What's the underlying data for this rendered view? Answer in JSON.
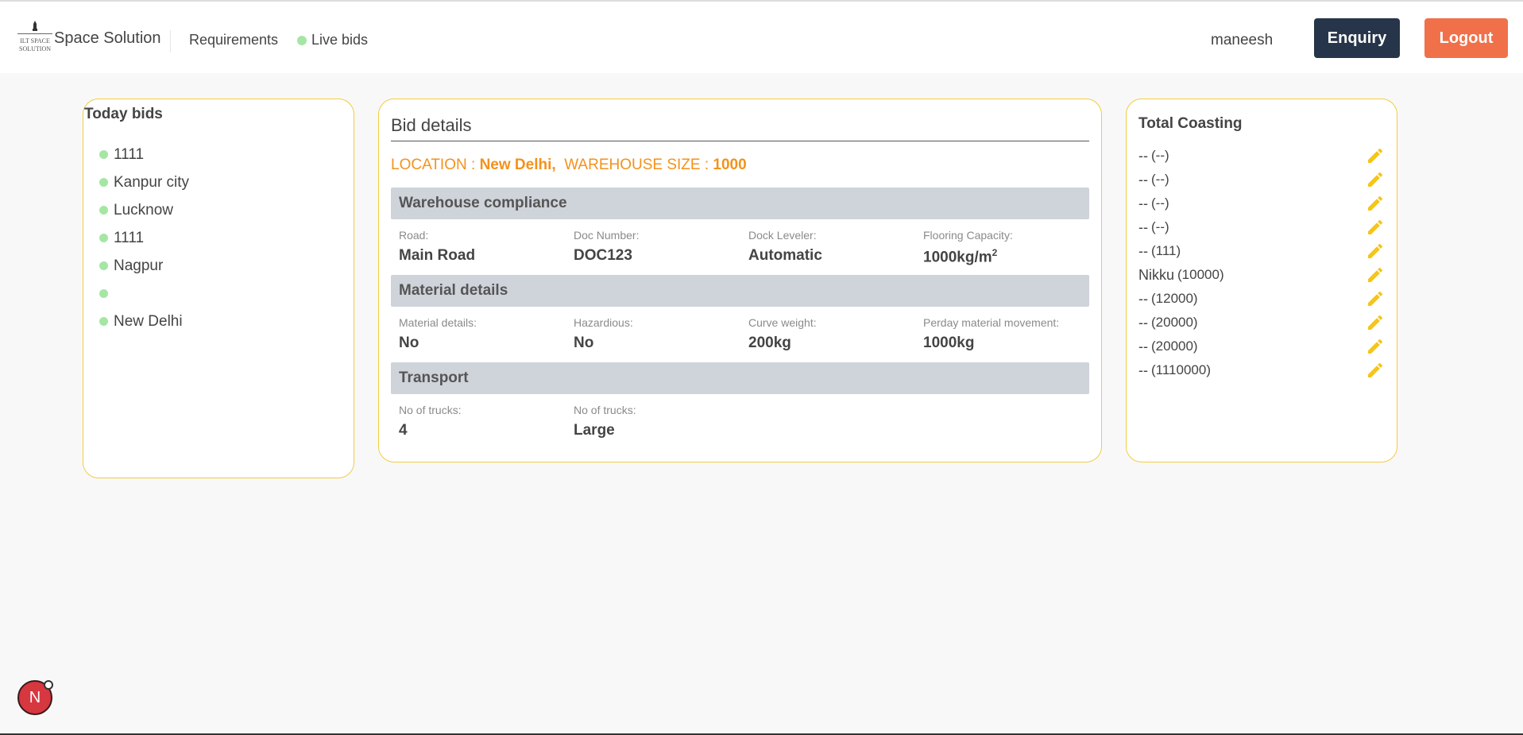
{
  "header": {
    "brand": "Space Solution",
    "logo_text": "ILT SPACE SOLUTION",
    "nav": {
      "requirements": "Requirements",
      "live_bids": "Live bids"
    },
    "username": "maneesh",
    "enquiry_label": "Enquiry",
    "logout_label": "Logout",
    "colors": {
      "enquiry_bg": "#263549",
      "logout_bg": "#f0704a",
      "live_dot": "#a5e6a5"
    }
  },
  "today_bids": {
    "title": "Today bids",
    "items": [
      {
        "label": "1111"
      },
      {
        "label": "Kanpur city"
      },
      {
        "label": "Lucknow"
      },
      {
        "label": "1111"
      },
      {
        "label": "Nagpur"
      },
      {
        "label": ""
      },
      {
        "label": "New Delhi"
      }
    ]
  },
  "bid_details": {
    "title": "Bid details",
    "location_label": "LOCATION : ",
    "location_value": "New Delhi,",
    "size_label": "WAREHOUSE SIZE : ",
    "size_value": "1000",
    "accent_color": "#f3921b",
    "sections": {
      "compliance": {
        "title": "Warehouse compliance",
        "fields": [
          {
            "label": "Road:",
            "value": "Main Road"
          },
          {
            "label": "Doc Number:",
            "value": "DOC123"
          },
          {
            "label": "Dock Leveler:",
            "value": "Automatic"
          },
          {
            "label": "Flooring Capacity:",
            "value": "1000kg/m",
            "sup": "2"
          }
        ]
      },
      "material": {
        "title": "Material details",
        "fields": [
          {
            "label": "Material details:",
            "value": "No"
          },
          {
            "label": "Hazardious:",
            "value": "No"
          },
          {
            "label": "Curve weight:",
            "value": "200kg"
          },
          {
            "label": "Perday material movement:",
            "value": "1000kg"
          }
        ]
      },
      "transport": {
        "title": "Transport",
        "fields": [
          {
            "label": "No of trucks:",
            "value": "4"
          },
          {
            "label": "No of trucks:",
            "value": "Large"
          }
        ]
      }
    }
  },
  "total_coasting": {
    "title": "Total Coasting",
    "rows": [
      {
        "name": "--",
        "amount": "(--)"
      },
      {
        "name": "--",
        "amount": "(--)"
      },
      {
        "name": "--",
        "amount": "(--)"
      },
      {
        "name": "--",
        "amount": "(--)"
      },
      {
        "name": "--",
        "amount": "(111)"
      },
      {
        "name": "Nikku",
        "amount": "(10000)"
      },
      {
        "name": "--",
        "amount": "(12000)"
      },
      {
        "name": "--",
        "amount": "(20000)"
      },
      {
        "name": "--",
        "amount": "(20000)"
      },
      {
        "name": "--",
        "amount": "(1110000)"
      }
    ],
    "edit_icon": "pencil-icon",
    "edit_icon_color": "#f5c518"
  },
  "fab": {
    "label": "N"
  }
}
